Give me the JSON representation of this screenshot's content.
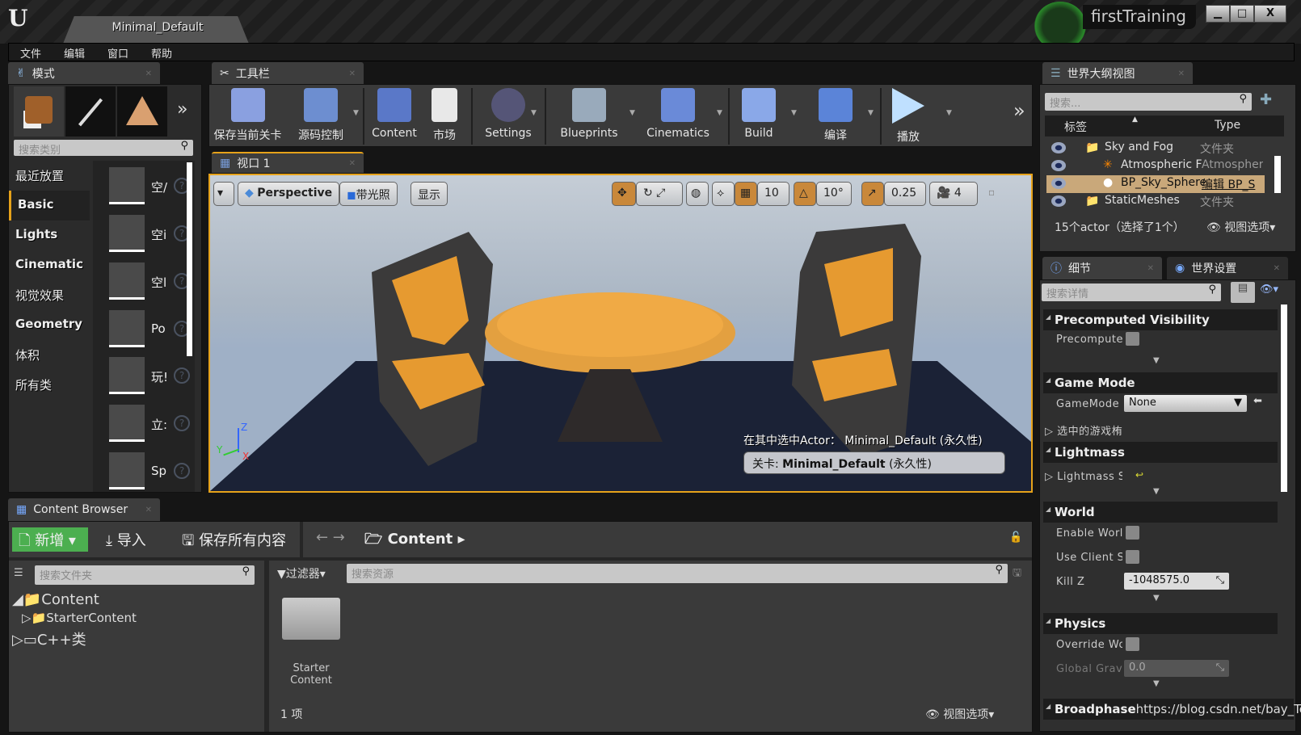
{
  "window": {
    "doc_tab": "Minimal_Default",
    "project": "firstTraining",
    "controls": [
      "minimize",
      "maximize",
      "close"
    ]
  },
  "menu": [
    "文件",
    "编辑",
    "窗口",
    "帮助"
  ],
  "modes": {
    "tab": "模式",
    "search_placeholder": "搜索类别",
    "categories": [
      "最近放置",
      "Basic",
      "Lights",
      "Cinematic",
      "视觉效果",
      "Geometry",
      "体积",
      "所有类"
    ],
    "selected": "Basic",
    "items": [
      "空Actor",
      "空角色",
      "空Pawn",
      "Point Light",
      "玩家出生点",
      "立方体",
      "Sphere"
    ],
    "items_visible": [
      "空/",
      "空i",
      "空l",
      "Po",
      "玩!",
      "立:",
      "Sp"
    ]
  },
  "toolbar": {
    "tab": "工具栏",
    "buttons": [
      "保存当前关卡",
      "源码控制",
      "Content",
      "市场",
      "Settings",
      "Blueprints",
      "Cinematics",
      "Build",
      "编译",
      "播放"
    ]
  },
  "viewport": {
    "tab": "视口 1",
    "perspective": "Perspective",
    "lighting": "带光照",
    "show": "显示",
    "grid_snap": "10",
    "rot_snap": "10°",
    "scale_snap": "0.25",
    "cam_speed": "4",
    "selected_actor_label": "在其中选中Actor：",
    "selected_actor_value": "Minimal_Default (永久性)",
    "level_label": "关卡:",
    "level_value": "Minimal_Default",
    "level_suffix": "(永久性)",
    "axis": {
      "x": "X",
      "y": "Y",
      "z": "Z"
    }
  },
  "outliner": {
    "tab": "世界大纲视图",
    "search_placeholder": "搜索...",
    "col_label": "标签",
    "col_type": "Type",
    "rows": [
      {
        "label": "Sky and Fog",
        "type": "文件夹"
      },
      {
        "label": "Atmospheric Fog",
        "visible": "Atmospheric F",
        "type": "Atmospheric Fog",
        "type_visible": "Atmospher"
      },
      {
        "label": "BP_Sky_Sphere",
        "type": "编辑 BP_Sky_Sphere",
        "type_visible": "编辑 BP_S",
        "selected": true
      },
      {
        "label": "StaticMeshes",
        "type": "文件夹"
      }
    ],
    "status": "15个actor（选择了1个）",
    "view_options": "视图选项"
  },
  "details": {
    "tab_details": "细节",
    "tab_world": "世界设置",
    "search_placeholder": "搜索详情",
    "sections": [
      {
        "title": "Precomputed Visibility",
        "props": [
          {
            "label": "Precompute",
            "type": "checkbox",
            "value": false
          }
        ]
      },
      {
        "title": "Game Mode",
        "props": [
          {
            "label": "GameMode",
            "type": "select",
            "value": "None"
          },
          {
            "label": "选中的游戏模式",
            "visible": "选中的游戏栯",
            "type": "group"
          }
        ]
      },
      {
        "title": "Lightmass",
        "props": [
          {
            "label": "Lightmass S",
            "type": "group"
          }
        ]
      },
      {
        "title": "World",
        "props": [
          {
            "label": "Enable World",
            "type": "checkbox",
            "value": false
          },
          {
            "label": "Use Client Si",
            "type": "checkbox",
            "value": false
          },
          {
            "label": "Kill Z",
            "type": "number",
            "value": "-1048575.0"
          }
        ]
      },
      {
        "title": "Physics",
        "props": [
          {
            "label": "Override Wor",
            "type": "checkbox",
            "value": false
          },
          {
            "label": "Global Gravit",
            "type": "number",
            "value": "0.0"
          }
        ]
      },
      {
        "title": "Broadphase"
      }
    ],
    "watermark": "https://blog.csdn.net/bay_Tong"
  },
  "content_browser": {
    "tab": "Content Browser",
    "new": "新增",
    "import": "导入",
    "save_all": "保存所有内容",
    "path": "Content",
    "folder_search_placeholder": "搜索文件夹",
    "filter": "过滤器",
    "asset_search_placeholder": "搜索资源",
    "tree": [
      {
        "label": "Content",
        "children": [
          {
            "label": "StarterContent"
          }
        ]
      },
      {
        "label": "C++类"
      }
    ],
    "assets": [
      {
        "label": "Starter Content"
      }
    ],
    "count": "1 项",
    "view_options": "视图选项"
  },
  "colors": {
    "accent": "#e6a21a",
    "new_button": "#4caf50",
    "selected_row": "#c9a87a"
  }
}
